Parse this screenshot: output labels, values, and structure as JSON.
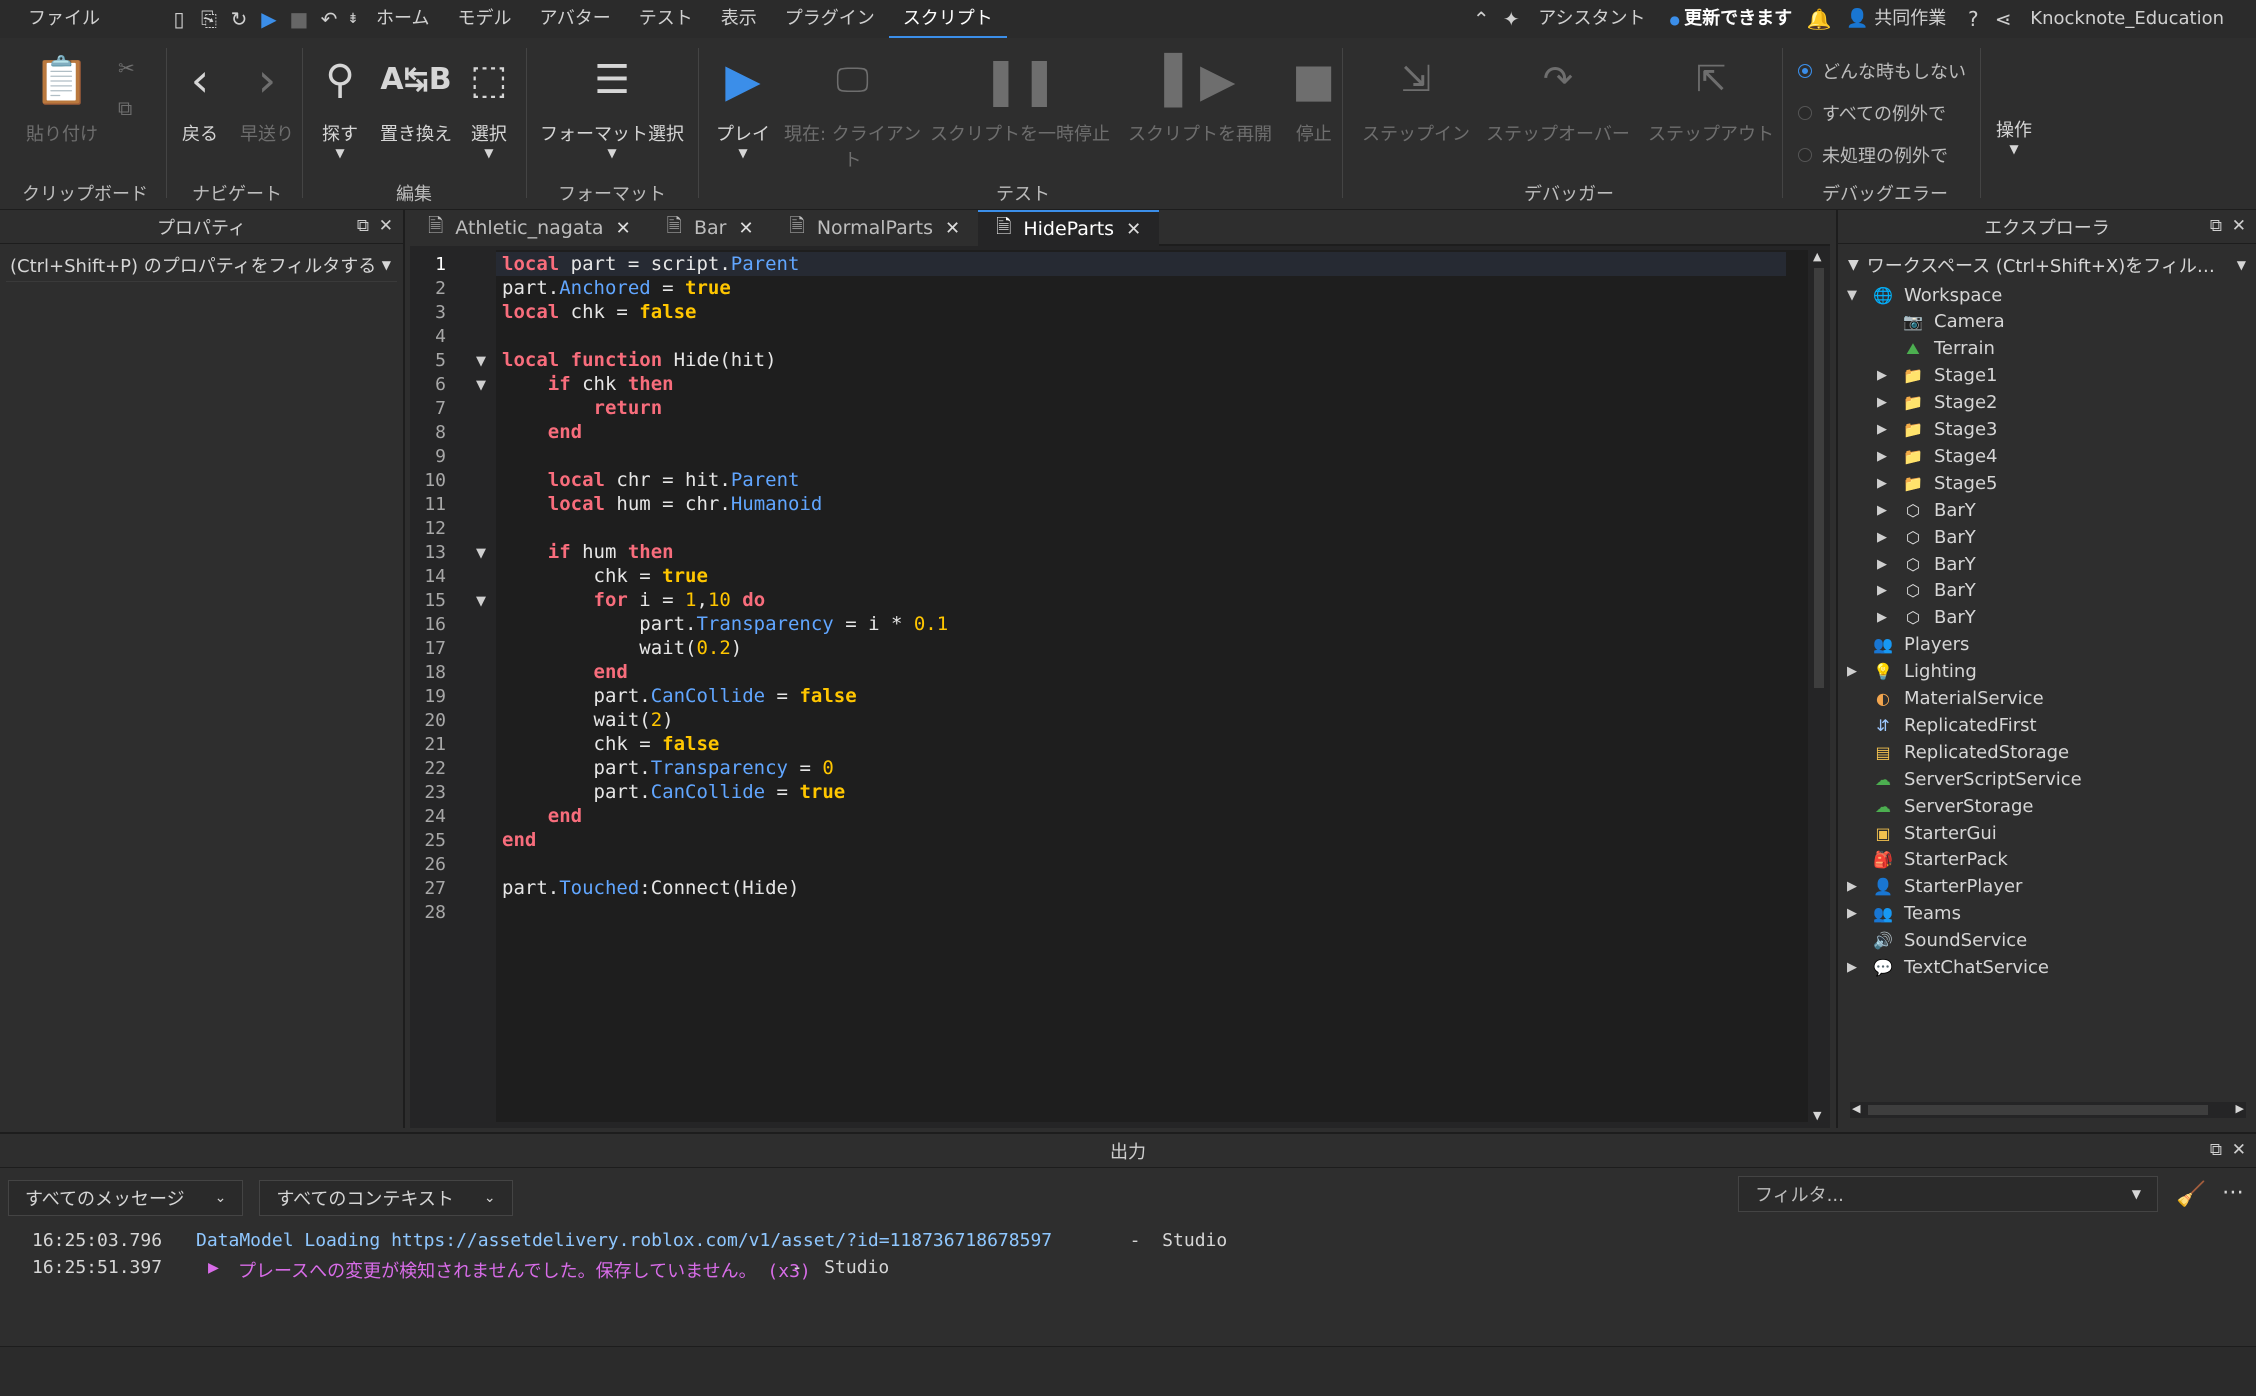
{
  "menubar": {
    "file": "ファイル",
    "tabs": [
      "ホーム",
      "モデル",
      "アバター",
      "テスト",
      "表示",
      "プラグイン",
      "スクリプト"
    ],
    "assistant": "アシスタント",
    "update": "更新できます",
    "collab": "共同作業",
    "user": "Knocknote_Education"
  },
  "ribbon": {
    "paste": "貼り付け",
    "back": "戻る",
    "forward": "早送り",
    "find": "探す",
    "replace": "置き換え",
    "select": "選択",
    "format_select": "フォーマット選択",
    "play": "プレイ",
    "current_client": "現在: クライアン\nト",
    "pause_script": "スクリプトを一時停止",
    "resume_script": "スクリプトを再開",
    "stop": "停止",
    "step_in": "ステップイン",
    "step_over": "ステップオーバー",
    "step_out": "ステップアウト",
    "radio_never": "どんな時もしない",
    "radio_all": "すべての例外で",
    "radio_unhandled": "未処理の例外で",
    "ops": "操作",
    "groups": {
      "clipboard": "クリップボード",
      "navigate": "ナビゲート",
      "edit": "編集",
      "format": "フォーマット",
      "test": "テスト",
      "debugger": "デバッガー",
      "debug_error": "デバッグエラー"
    }
  },
  "properties": {
    "title": "プロパティ",
    "filter": "(Ctrl+Shift+P) のプロパティをフィルタする"
  },
  "editor": {
    "tabs": [
      "Athletic_nagata",
      "Bar",
      "NormalParts",
      "HideParts"
    ],
    "active_tab": "HideParts",
    "line_numbers": [
      "1",
      "2",
      "3",
      "4",
      "5",
      "6",
      "7",
      "8",
      "9",
      "10",
      "11",
      "12",
      "13",
      "14",
      "15",
      "16",
      "17",
      "18",
      "19",
      "20",
      "21",
      "22",
      "23",
      "24",
      "25",
      "26",
      "27",
      "28"
    ]
  },
  "explorer": {
    "title": "エクスプローラ",
    "filter": "ワークスペース (Ctrl+Shift+X)をフィル…",
    "items": [
      "Workspace",
      "Camera",
      "Terrain",
      "Stage1",
      "Stage2",
      "Stage3",
      "Stage4",
      "Stage5",
      "BarY",
      "BarY",
      "BarY",
      "BarY",
      "BarY",
      "Players",
      "Lighting",
      "MaterialService",
      "ReplicatedFirst",
      "ReplicatedStorage",
      "ServerScriptService",
      "ServerStorage",
      "StarterGui",
      "StarterPack",
      "StarterPlayer",
      "Teams",
      "SoundService",
      "TextChatService"
    ]
  },
  "output": {
    "title": "出力",
    "messages_filter": "すべてのメッセージ",
    "context_filter": "すべてのコンテキスト",
    "filter_placeholder": "フィルタ...",
    "lines": [
      {
        "time": "16:25:03.796",
        "text": "DataModel Loading https://assetdelivery.roblox.com/v1/asset/?id=118736718678597",
        "source": "  -  Studio"
      },
      {
        "time": "16:25:51.397",
        "text": "プレースへの変更が検知されませんでした。保存していません。 (x3)",
        "source": "  -  Studio"
      }
    ]
  },
  "colors": {
    "keyword": "#f86d7c",
    "bool": "#ffc600",
    "property": "#61a6ff",
    "accent": "#3b8ee9"
  }
}
